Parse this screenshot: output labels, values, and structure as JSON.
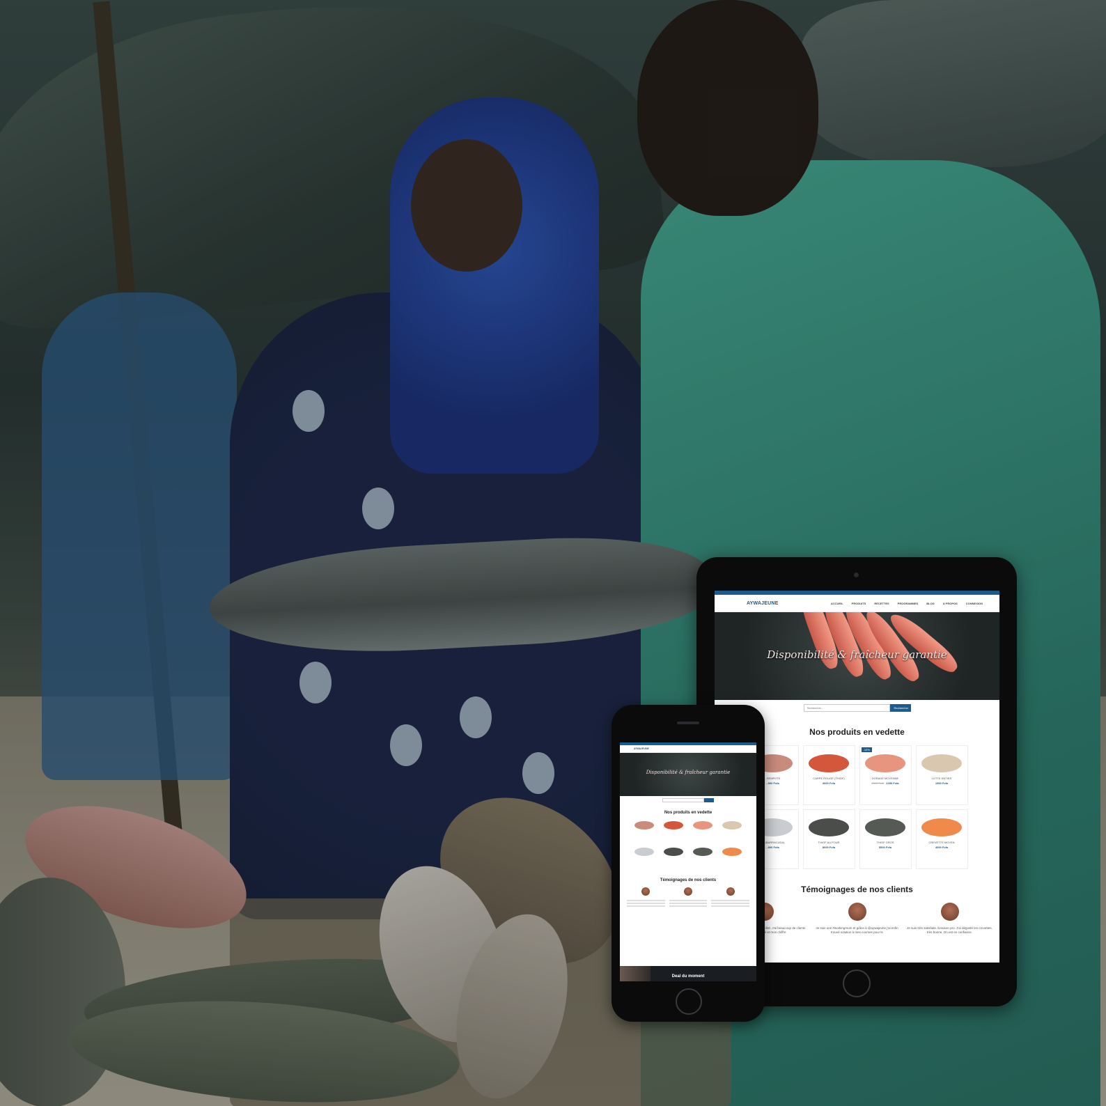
{
  "tablet_site": {
    "logo": "AYWAJEUNE",
    "nav": [
      "ACCUEIL",
      "PRODUITS",
      "RECETTES",
      "PROGRAMMES",
      "BLOG",
      "A PROPOS",
      "CONNEXION"
    ],
    "hero_title": "Disponibilité & fraîcheur garantie",
    "search_placeholder": "Rechercher...",
    "search_button": "Rechercher",
    "featured_title": "Nos produits en vedette",
    "products": [
      {
        "name": "...SEMPOTE",
        "price": "...500 Fcfa",
        "old_price": "",
        "badge": "",
        "color": "#c98b7c"
      },
      {
        "name": "CARPE ROUGE (THIOF)",
        "price": "3000 Fcfa",
        "old_price": "",
        "badge": "",
        "color": "#d4573c"
      },
      {
        "name": "DORADE MOYENNE",
        "price": "2250 Fcfa",
        "old_price": "2500 Fcfa",
        "badge": "-10%",
        "color": "#e8957f"
      },
      {
        "name": "LOTTE ENTIER",
        "price": "1500 Fcfa",
        "old_price": "",
        "badge": "",
        "color": "#d9c7b0"
      },
      {
        "name": "...E (BARRACUDA)",
        "price": "...800 Fcfa",
        "old_price": "",
        "badge": "",
        "color": "#c9ccd0"
      },
      {
        "name": "THIOF AU FOUR",
        "price": "8000 Fcfa",
        "old_price": "",
        "badge": "",
        "color": "#4a4d4a"
      },
      {
        "name": "THIOF GROS",
        "price": "5500 Fcfa",
        "old_price": "",
        "badge": "",
        "color": "#555a55"
      },
      {
        "name": "CREVETTE MOYEN",
        "price": "4000 Fcfa",
        "old_price": "",
        "badge": "",
        "color": "#f08a4b"
      }
    ],
    "testimonials_title": "Témoignages de nos clients",
    "testimonials": [
      "...jeune m'a apporté plus de ...ilité. J'ai beaucoup de clients ...l'approvisionné et mon chiffre",
      "Je suis une #workingmum et grâce à @aywajeune j'ai enfin trouvé solution à mes courses pour le",
      "Je suis très satisfaite. livraison pro. J'ai dégusté les crevettes. très bonne. On est en confiance."
    ]
  },
  "phone_site": {
    "logo": "AYWAJEUNE",
    "hero_title": "Disponibilité & fraîcheur garantie",
    "featured_title": "Nos produits en vedette",
    "testimonials_title": "Témoignages de nos clients",
    "deal_label": "Deal du moment"
  }
}
